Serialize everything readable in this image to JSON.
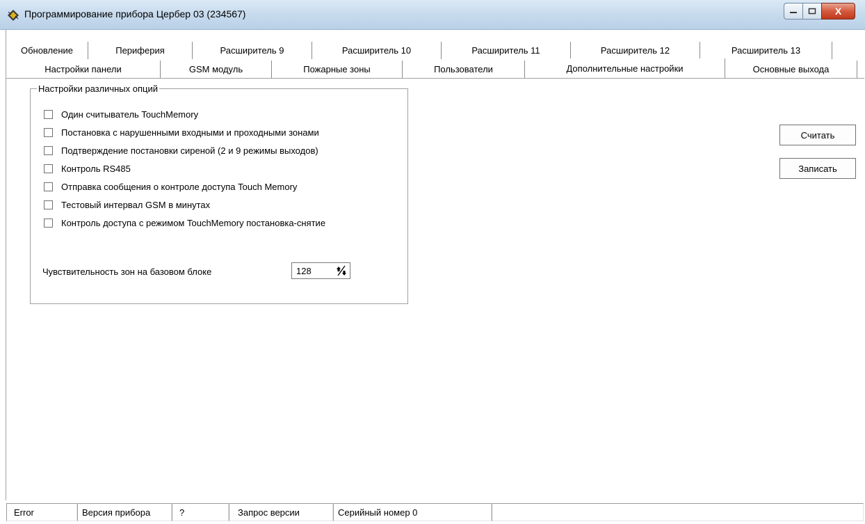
{
  "window": {
    "title": "Программирование прибора Цербер 03 (234567)",
    "controls": {
      "minimize": "–",
      "maximize": "□",
      "close": "X"
    }
  },
  "tabs": {
    "row1": [
      "Обновление",
      "Периферия",
      "Расширитель 9",
      "Расширитель 10",
      "Расширитель 11",
      "Расширитель 12",
      "Расширитель 13"
    ],
    "row2": [
      "Настройки панели",
      "GSM модуль",
      "Пожарные зоны",
      "Пользователи",
      "Дополнительные настройки",
      "Основные выхода"
    ],
    "active": "Дополнительные настройки"
  },
  "options_group": {
    "title": "Настройки различных опций",
    "options": [
      {
        "label": "Один считыватель TouchMemory",
        "checked": false
      },
      {
        "label": "Постановка с нарушенными входными и проходными зонами",
        "checked": false
      },
      {
        "label": "Подтверждение постановки сиреной (2 и 9 режимы выходов)",
        "checked": false
      },
      {
        "label": "Контроль RS485",
        "checked": false
      },
      {
        "label": "Отправка сообщения о контроле доступа Touch Memory",
        "checked": false
      },
      {
        "label": "Тестовый интервал GSM в минутах",
        "checked": false
      },
      {
        "label": "Контроль доступа с режимом TouchMemory постановка-снятие",
        "checked": false
      }
    ],
    "sensitivity_label": "Чувствительность зон на базовом блоке",
    "sensitivity_value": "128"
  },
  "buttons": {
    "read": "Считать",
    "write": "Записать"
  },
  "statusbar": {
    "error": "Error",
    "version_label": "Версия прибора",
    "version_value": "?",
    "version_request": "Запрос версии",
    "serial": "Серийный номер 0"
  }
}
